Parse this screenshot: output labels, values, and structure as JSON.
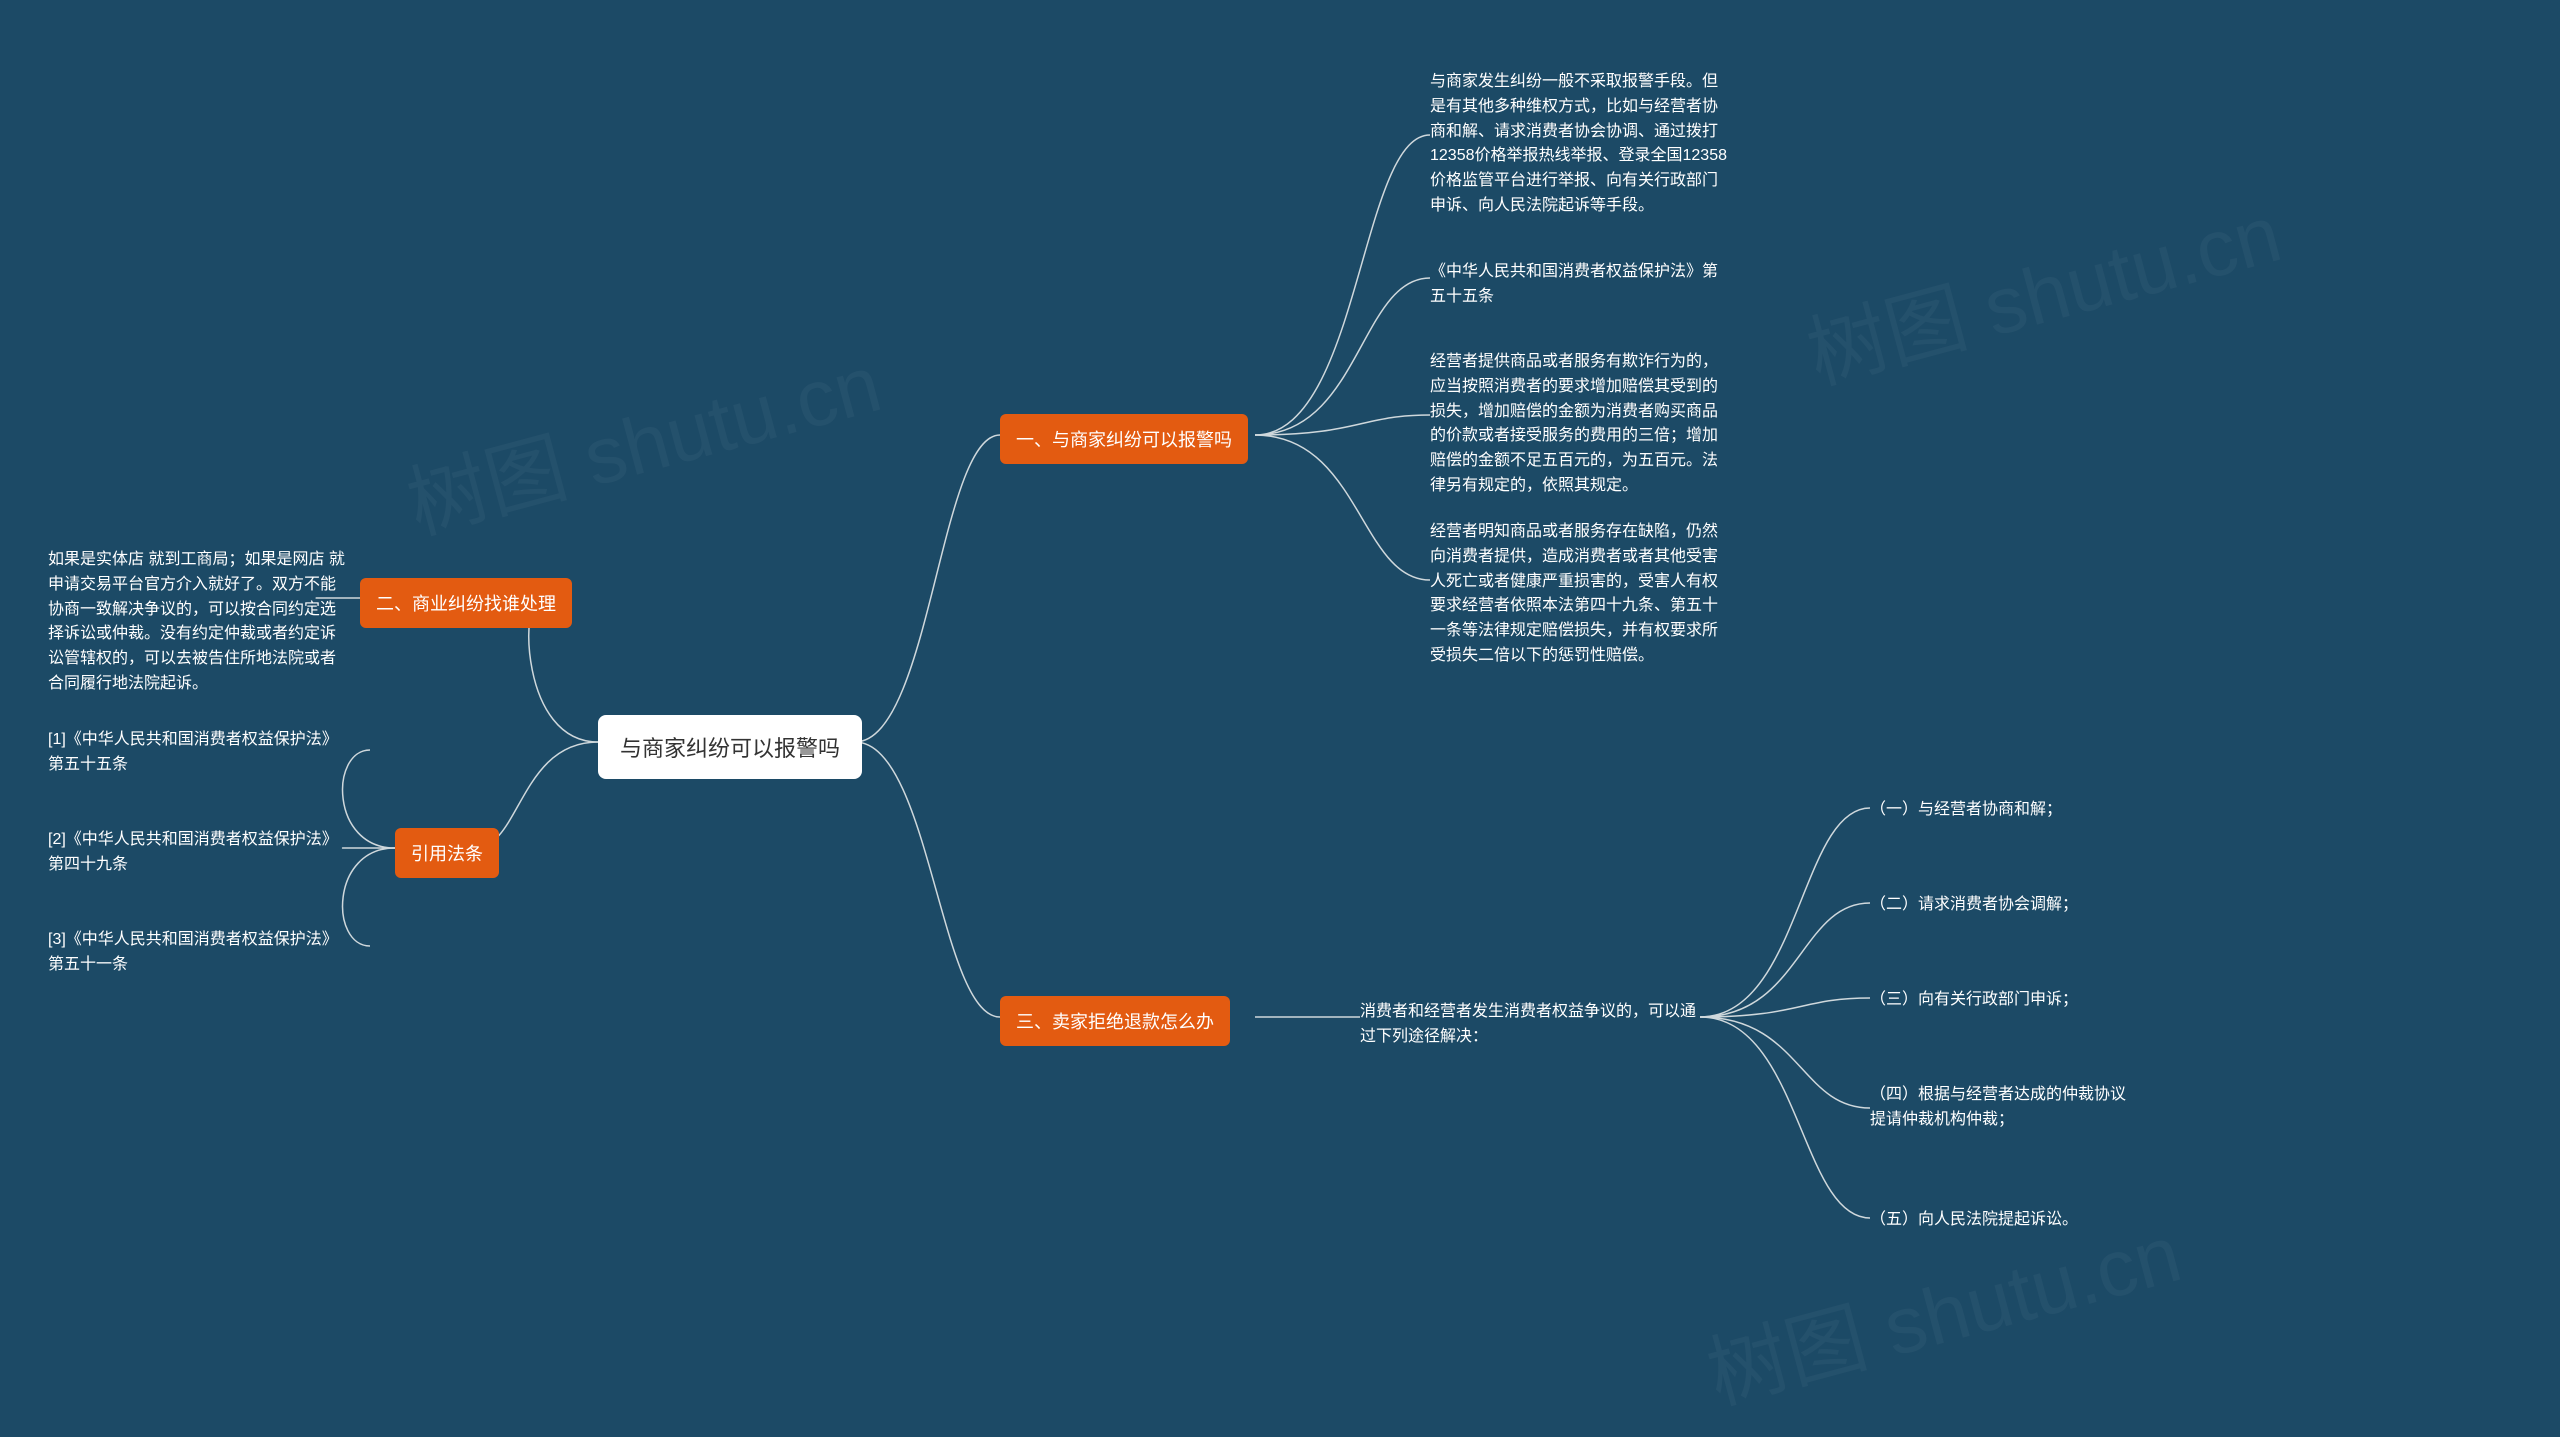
{
  "root": {
    "title": "与商家纠纷可以报警吗"
  },
  "right": {
    "branch1": {
      "title": "一、与商家纠纷可以报警吗",
      "leaf1": "与商家发生纠纷一般不采取报警手段。但是有其他多种维权方式，比如与经营者协商和解、请求消费者协会协调、通过拨打12358价格举报热线举报、登录全国12358价格监管平台进行举报、向有关行政部门申诉、向人民法院起诉等手段。",
      "leaf2": "《中华人民共和国消费者权益保护法》第五十五条",
      "leaf3": "经营者提供商品或者服务有欺诈行为的，应当按照消费者的要求增加赔偿其受到的损失，增加赔偿的金额为消费者购买商品的价款或者接受服务的费用的三倍；增加赔偿的金额不足五百元的，为五百元。法律另有规定的，依照其规定。",
      "leaf4": "经营者明知商品或者服务存在缺陷，仍然向消费者提供，造成消费者或者其他受害人死亡或者健康严重损害的，受害人有权要求经营者依照本法第四十九条、第五十一条等法律规定赔偿损失，并有权要求所受损失二倍以下的惩罚性赔偿。"
    },
    "branch3": {
      "title": "三、卖家拒绝退款怎么办",
      "intro": "消费者和经营者发生消费者权益争议的，可以通过下列途径解决：",
      "opt1": "（一）与经营者协商和解；",
      "opt2": "（二）请求消费者协会调解；",
      "opt3": "（三）向有关行政部门申诉；",
      "opt4": "（四）根据与经营者达成的仲裁协议提请仲裁机构仲裁；",
      "opt5": "（五）向人民法院提起诉讼。"
    }
  },
  "left": {
    "branch2": {
      "title": "二、商业纠纷找谁处理",
      "leaf1": "如果是实体店 就到工商局；如果是网店 就申请交易平台官方介入就好了。双方不能协商一致解决争议的，可以按合同约定选择诉讼或仲裁。没有约定仲裁或者约定诉讼管辖权的，可以去被告住所地法院或者合同履行地法院起诉。"
    },
    "branchLaw": {
      "title": "引用法条",
      "leaf1": "[1]《中华人民共和国消费者权益保护法》 第五十五条",
      "leaf2": "[2]《中华人民共和国消费者权益保护法》 第四十九条",
      "leaf3": "[3]《中华人民共和国消费者权益保护法》 第五十一条"
    }
  },
  "watermark": "树图 shutu.cn",
  "colors": {
    "background": "#1c4a66",
    "root_bg": "#ffffff",
    "branch_bg": "#e35b11",
    "text": "#ffffff",
    "line": "#cfd8dc"
  }
}
